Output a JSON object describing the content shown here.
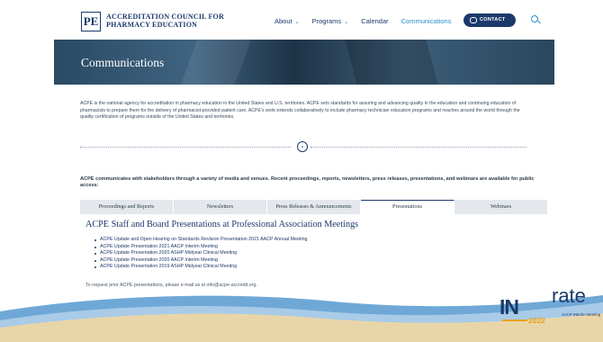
{
  "header": {
    "logo_mark": "PE",
    "org_name_line1": "ACCREDITATION COUNCIL FOR",
    "org_name_line2": "PHARMACY EDUCATION",
    "nav": [
      {
        "label": "About",
        "has_dropdown": true
      },
      {
        "label": "Programs",
        "has_dropdown": true
      },
      {
        "label": "Calendar",
        "has_dropdown": false
      },
      {
        "label": "Communications",
        "has_dropdown": false,
        "active": true
      }
    ],
    "contact_label": "CONTACT"
  },
  "hero": {
    "title": "Communications"
  },
  "intro": "ACPE is the national agency for accreditation in pharmacy education in the United States and U.S. territories. ACPE sets standards for assuring and advancing quality in the education and continuing education of pharmacists to prepare them for the delivery of pharmacist-provided patient care. ACPE's work extends collaboratively to include pharmacy technician education programs and reaches around the world through the quality certification of programs outside of the United States and territories.",
  "lead": "ACPE communicates with stakeholders through a variety of media and venues. Recent proceedings, reports, newsletters, press releases, presentations, and webinars are available for public access:",
  "tabs": [
    {
      "label": "Proceedings and Reports",
      "active": false
    },
    {
      "label": "Newsletters",
      "active": false
    },
    {
      "label": "Press Releases & Announcements",
      "active": false
    },
    {
      "label": "Presentations",
      "active": true
    },
    {
      "label": "Webinars",
      "active": false
    }
  ],
  "panel": {
    "title": "ACPE Staff and Board Presentations at Professional Association Meetings",
    "items": [
      "ACPE Update and Open Hearing on Standards Revision Presentation 2021 AACP Annual Meeting",
      "ACPE Update Presentation 2021 AACP Interim Meeting",
      "ACPE Update Presentation 2020 ASHP Midyear Clinical Meeting",
      "ACPE Update Presentation 2020 AACP Interim Meeting",
      "ACPE Update Presentation 2019 ASHP Midyear Clinical Meeting"
    ],
    "request_note": "To request prior ACPE presentations, please e-mail us at info@acpe-accredit.org."
  },
  "branding": {
    "word_part1": "IN",
    "word_part2": "rate",
    "year": "2022",
    "subtitle": "AACP INterim Meeting"
  },
  "colors": {
    "navy": "#1b3a6b",
    "accent_blue": "#2b8fc9",
    "gold": "#e8a21b",
    "wave_blue": "#6fa8d6",
    "wave_sand": "#e9d6a8"
  }
}
